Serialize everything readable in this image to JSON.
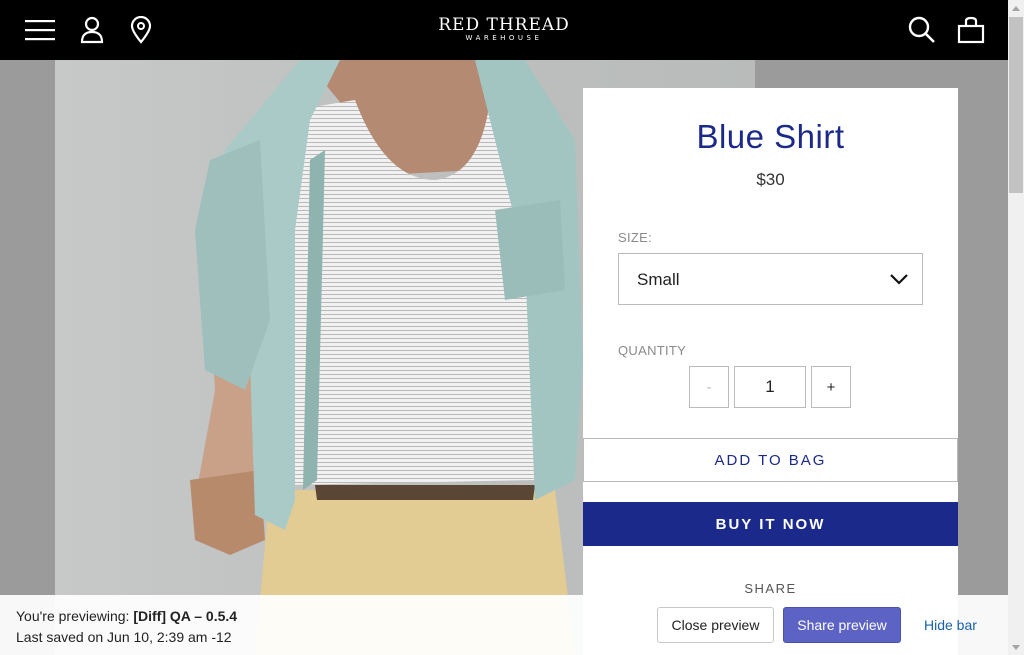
{
  "header": {
    "brand_line1": "RED THREAD",
    "brand_line2": "WAREHOUSE",
    "background_color": "#000000",
    "icons": [
      "menu-icon",
      "account-icon",
      "location-pin-icon",
      "search-icon",
      "shopping-bag-icon"
    ]
  },
  "product": {
    "title": "Blue Shirt",
    "price": "$30",
    "size_label": "SIZE:",
    "size_value": "Small",
    "quantity_label": "QUANTITY",
    "quantity_minus": "-",
    "quantity_value": "1",
    "quantity_plus": "+",
    "add_to_bag": "ADD TO BAG",
    "buy_now": "BUY IT NOW",
    "share_label": "SHARE",
    "accent_color": "#1b2a8a"
  },
  "preview_bar": {
    "prefix": "You're previewing:",
    "theme_name": "[Diff] QA – 0.5.4",
    "last_saved": "Last saved on Jun 10, 2:39 am -12",
    "close_label": "Close preview",
    "share_label": "Share preview",
    "hide_label": "Hide bar",
    "share_button_color": "#5c63c4"
  }
}
